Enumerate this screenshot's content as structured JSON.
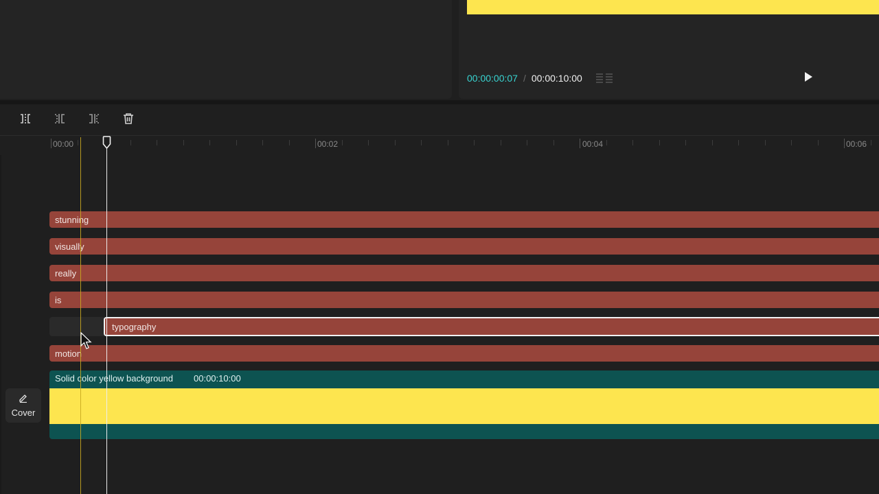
{
  "preview": {
    "current_time": "00:00:00:07",
    "separator": "/",
    "total_time": "00:00:10:00"
  },
  "ruler": {
    "labels": [
      "00:00",
      "00:02",
      "00:04",
      "00:06"
    ]
  },
  "tracks": [
    {
      "label": "stunning"
    },
    {
      "label": "visually"
    },
    {
      "label": "really"
    },
    {
      "label": "is"
    },
    {
      "label": "typography",
      "selected": true
    },
    {
      "label": "motion"
    }
  ],
  "background_clip": {
    "label": "Solid color yellow background",
    "duration": "00:00:10:00"
  },
  "cover": {
    "label": "Cover"
  },
  "colors": {
    "text_track": "#96443a",
    "bg_track": "#0d5351",
    "yellow": "#fde54f",
    "accent_time": "#38d4d1"
  },
  "icons": {
    "split": "split-icon",
    "split_left": "split-left-icon",
    "split_right": "split-right-icon",
    "delete": "trash-icon",
    "play": "play-icon",
    "grid": "grid-icon",
    "cover_edit": "pencil-icon"
  }
}
